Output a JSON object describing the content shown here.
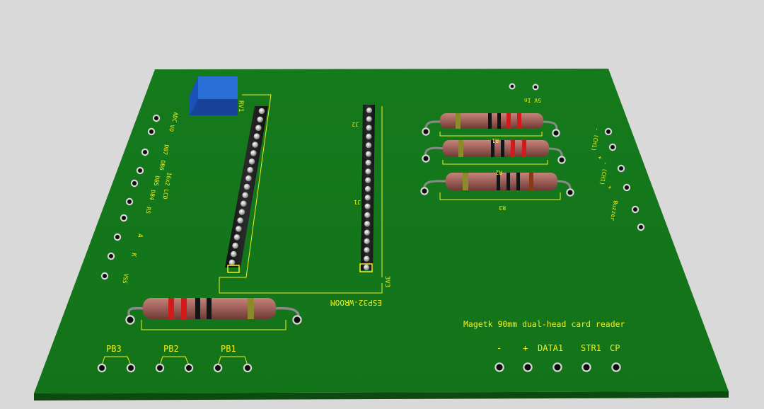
{
  "board": {
    "title_label": "Magetk 90mm dual-head card reader",
    "module_label": "ESP32-WROOM",
    "left_header_labels": [
      "3V3",
      "J2"
    ],
    "right_header_labels": [
      "J2",
      "J1"
    ],
    "lcd_labels": [
      "ADC",
      "VO",
      "DB7",
      "DB6",
      "16x2 LCD",
      "DB5",
      "DB4",
      "RS",
      "A",
      "K",
      "VSS"
    ],
    "right_edge_labels": [
      "- (CH1)",
      "+",
      "- (CH1)",
      "+",
      "Buzzer"
    ],
    "top_right_label": "5V In",
    "resistor_labels": [
      "R1",
      "R2",
      "R3"
    ],
    "button_labels": [
      "PB3",
      "PB2",
      "PB1"
    ],
    "connector_labels": [
      "-",
      "+",
      "DATA1",
      "STR1",
      "CP"
    ],
    "pot_label": "RV1"
  },
  "colors": {
    "background": "#d9d9d9",
    "board_top": "#157a1c",
    "board_edge": "#0c4a10",
    "silkscreen": "#f2ef1e",
    "header_plastic": "#1a1a1a",
    "potentiometer": "#1f5fc9",
    "resistor_body": "#a0625b"
  },
  "icons": {
    "pad": "pad-icon",
    "pin": "header-pin-icon",
    "potentiometer": "potentiometer-icon"
  }
}
